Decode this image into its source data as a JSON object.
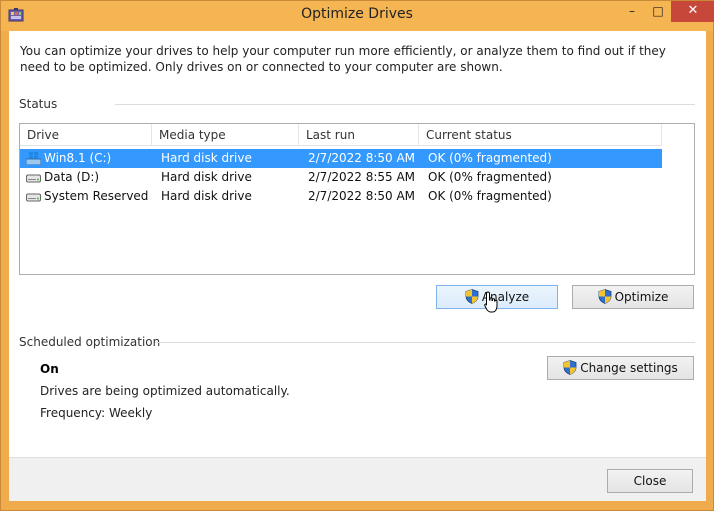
{
  "window": {
    "title": "Optimize Drives",
    "minimize_glyph": "–",
    "maximize_glyph": "□",
    "close_glyph": "✕"
  },
  "intro_text": "You can optimize your drives to help your computer run more efficiently, or analyze them to find out if they need to be optimized. Only drives on or connected to your computer are shown.",
  "status": {
    "label": "Status",
    "columns": [
      "Drive",
      "Media type",
      "Last run",
      "Current status"
    ],
    "rows": [
      {
        "drive": "Win8.1 (C:)",
        "media": "Hard disk drive",
        "last_run": "2/7/2022 8:50 AM",
        "status": "OK (0% fragmented)",
        "icon": "windows-drive-icon",
        "selected": true
      },
      {
        "drive": "Data (D:)",
        "media": "Hard disk drive",
        "last_run": "2/7/2022 8:55 AM",
        "status": "OK (0% fragmented)",
        "icon": "hard-drive-icon",
        "selected": false
      },
      {
        "drive": "System Reserved",
        "media": "Hard disk drive",
        "last_run": "2/7/2022 8:50 AM",
        "status": "OK (0% fragmented)",
        "icon": "hard-drive-icon",
        "selected": false
      }
    ],
    "analyze_label": "Analyze",
    "optimize_label": "Optimize"
  },
  "scheduled": {
    "label": "Scheduled optimization",
    "state": "On",
    "description": "Drives are being optimized automatically.",
    "frequency": "Frequency: Weekly",
    "change_settings_label": "Change settings"
  },
  "footer": {
    "close_label": "Close"
  },
  "colors": {
    "titlebar": "#f5b553",
    "selection": "#3399ff",
    "close_button": "#c7473a"
  }
}
